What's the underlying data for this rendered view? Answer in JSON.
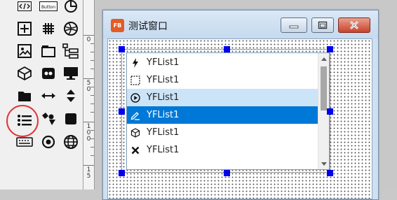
{
  "palette": {
    "tools": [
      {
        "name": "code-tag-icon",
        "symbol": "</>"
      },
      {
        "name": "button-control-icon",
        "label": "Button"
      },
      {
        "name": "pie-chart-icon"
      },
      {
        "name": "plus-grid-icon"
      },
      {
        "name": "grid-table-icon"
      },
      {
        "name": "globe-icon"
      },
      {
        "name": "image-icon"
      },
      {
        "name": "tab-folder-icon"
      },
      {
        "name": "tree-view-icon"
      },
      {
        "name": "cube-icon"
      },
      {
        "name": "media-icon"
      },
      {
        "name": "monitor-icon"
      },
      {
        "name": "folder-icon"
      },
      {
        "name": "horizontal-arrows-icon"
      },
      {
        "name": "vertical-arrows-icon"
      },
      {
        "name": "list-icon"
      },
      {
        "name": "shapes-icon"
      },
      {
        "name": "square-icon"
      },
      {
        "name": "keyboard-icon"
      },
      {
        "name": "radio-icon"
      },
      {
        "name": "web-globe-icon"
      }
    ],
    "highlighted_tool": "list-icon",
    "highlight_color": "#e0353a"
  },
  "ruler": {
    "labels": [
      {
        "text": "0"
      },
      {
        "text": "5\n0"
      },
      {
        "text": "1\n0\n0"
      },
      {
        "text": "1\n5"
      }
    ]
  },
  "window": {
    "title": "测试窗口",
    "app_icon_text": "FB",
    "buttons": {
      "minimize": "minimize-icon",
      "maximize": "maximize-icon",
      "close": "close-icon"
    }
  },
  "listbox": {
    "items": [
      {
        "label": "YFList1",
        "icon": "lightning-icon",
        "state": "normal"
      },
      {
        "label": "YFList1",
        "icon": "dashed-square-icon",
        "state": "normal"
      },
      {
        "label": "YFList1",
        "icon": "play-circle-icon",
        "state": "hover"
      },
      {
        "label": "YFList1",
        "icon": "pen-icon",
        "state": "selected"
      },
      {
        "label": "YFList1",
        "icon": "hexagon-icon",
        "state": "normal"
      },
      {
        "label": "YFList1",
        "icon": "x-mark-icon",
        "state": "normal"
      }
    ],
    "selected_color": "#0078d7",
    "hover_color": "#cce4f7"
  }
}
